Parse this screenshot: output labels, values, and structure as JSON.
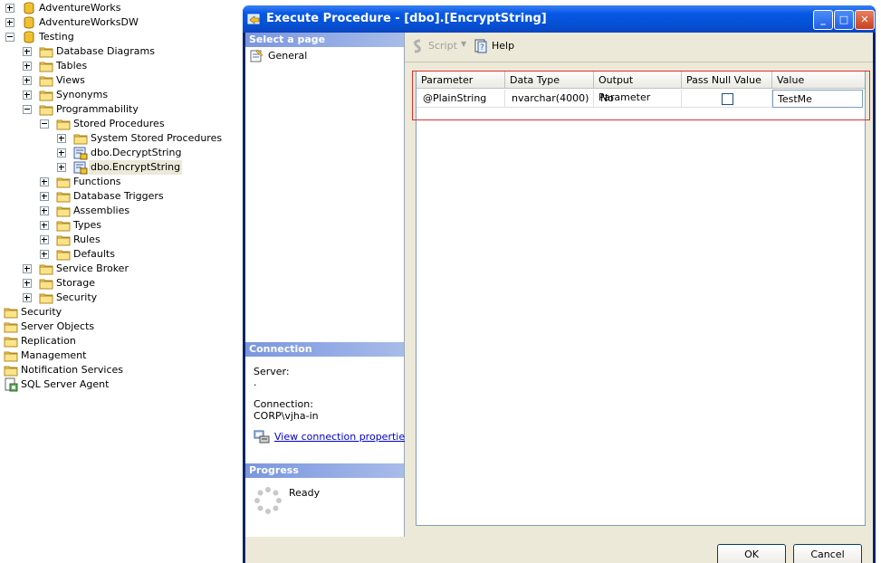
{
  "tree": {
    "nodes": [
      {
        "label": "AdventureWorks",
        "icon": "database-icon",
        "expander": "plus",
        "level": 0
      },
      {
        "label": "AdventureWorksDW",
        "icon": "database-icon",
        "expander": "plus",
        "level": 0
      },
      {
        "label": "Testing",
        "icon": "database-icon",
        "expander": "minus",
        "level": 0
      },
      {
        "label": "Database Diagrams",
        "icon": "folder-icon",
        "expander": "plus",
        "level": 1
      },
      {
        "label": "Tables",
        "icon": "folder-icon",
        "expander": "plus",
        "level": 1
      },
      {
        "label": "Views",
        "icon": "folder-icon",
        "expander": "plus",
        "level": 1
      },
      {
        "label": "Synonyms",
        "icon": "folder-icon",
        "expander": "plus",
        "level": 1
      },
      {
        "label": "Programmability",
        "icon": "folder-icon",
        "expander": "minus",
        "level": 1
      },
      {
        "label": "Stored Procedures",
        "icon": "folder-icon",
        "expander": "minus",
        "level": 2
      },
      {
        "label": "System Stored Procedures",
        "icon": "folder-icon",
        "expander": "plus",
        "level": 3
      },
      {
        "label": "dbo.DecryptString",
        "icon": "stored-procedure-icon",
        "expander": "plus",
        "level": 3
      },
      {
        "label": "dbo.EncryptString",
        "icon": "stored-procedure-icon",
        "expander": "plus",
        "level": 3,
        "selected": true
      },
      {
        "label": "Functions",
        "icon": "folder-icon",
        "expander": "plus",
        "level": 2
      },
      {
        "label": "Database Triggers",
        "icon": "folder-icon",
        "expander": "plus",
        "level": 2
      },
      {
        "label": "Assemblies",
        "icon": "folder-icon",
        "expander": "plus",
        "level": 2
      },
      {
        "label": "Types",
        "icon": "folder-icon",
        "expander": "plus",
        "level": 2
      },
      {
        "label": "Rules",
        "icon": "folder-icon",
        "expander": "plus",
        "level": 2
      },
      {
        "label": "Defaults",
        "icon": "folder-icon",
        "expander": "plus",
        "level": 2
      },
      {
        "label": "Service Broker",
        "icon": "folder-icon",
        "expander": "plus",
        "level": 1
      },
      {
        "label": "Storage",
        "icon": "folder-icon",
        "expander": "plus",
        "level": 1
      },
      {
        "label": "Security",
        "icon": "folder-icon",
        "expander": "plus",
        "level": 1
      },
      {
        "label": "Security",
        "icon": "folder-icon",
        "expander": "none",
        "level": -1
      },
      {
        "label": "Server Objects",
        "icon": "folder-icon",
        "expander": "none",
        "level": -1
      },
      {
        "label": "Replication",
        "icon": "folder-icon",
        "expander": "none",
        "level": -1
      },
      {
        "label": "Management",
        "icon": "folder-icon",
        "expander": "none",
        "level": -1
      },
      {
        "label": "Notification Services",
        "icon": "folder-icon",
        "expander": "none",
        "level": -1
      },
      {
        "label": "SQL Server Agent",
        "icon": "sql-agent-icon",
        "expander": "none",
        "level": -1
      }
    ]
  },
  "dialog": {
    "title": "Execute Procedure - [dbo].[EncryptString]",
    "select_page_header": "Select a page",
    "pages": [
      {
        "label": "General",
        "icon": "page-icon"
      }
    ],
    "connection_header": "Connection",
    "server_label": "Server:",
    "server_value": ".",
    "connection_label": "Connection:",
    "connection_value": "CORP\\vjha-in",
    "view_connection_link": "View connection properties",
    "progress_header": "Progress",
    "progress_status": "Ready",
    "toolbar": {
      "script_label": "Script",
      "help_label": "Help"
    },
    "grid": {
      "columns": [
        "Parameter",
        "Data Type",
        "Output Parameter",
        "Pass Null Value",
        "Value"
      ],
      "rows": [
        {
          "parameter": "@PlainString",
          "data_type": "nvarchar(4000)",
          "output": "No",
          "pass_null": false,
          "value": "TestMe"
        }
      ]
    },
    "ok_label": "OK",
    "cancel_label": "Cancel"
  },
  "colors": {
    "title_bar": "#0758e6",
    "section_header": "#7a96df",
    "highlight_border": "#e03030",
    "link": "#0000cc"
  }
}
